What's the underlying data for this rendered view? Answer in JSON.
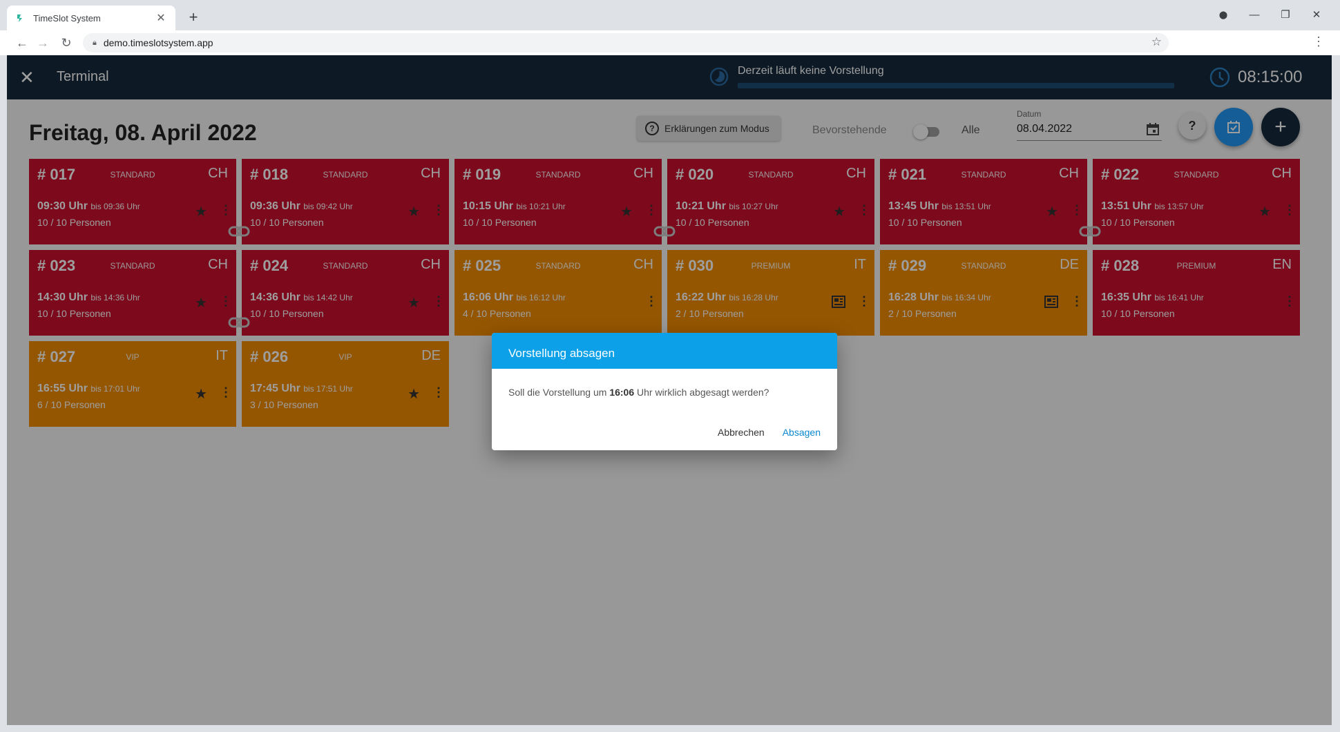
{
  "browser": {
    "tab_title": "TimeSlot System",
    "tab_close": "✕",
    "new_tab": "+",
    "url": "demo.timeslotsystem.app",
    "window_controls": {
      "profile": "⬤",
      "minimize": "—",
      "restore": "❐",
      "close": "✕"
    }
  },
  "appbar": {
    "close_icon": "✕",
    "title": "Terminal",
    "performance_status": "Derzeit läuft keine Vorstellung",
    "clock": "08:15:00"
  },
  "toolbar": {
    "heading": "Freitag, 08. April 2022",
    "explain_button": "Erklärungen zum Modus",
    "toggle_left": "Bevorstehende",
    "toggle_right": "Alle",
    "date_label": "Datum",
    "date_value": "08.04.2022",
    "help_label": "?",
    "add_label": "+"
  },
  "slots": [
    {
      "num": "# 017",
      "type": "STANDARD",
      "lang": "CH",
      "time": "09:30 Uhr",
      "until": "bis 09:36 Uhr",
      "persons": "10 / 10 Personen",
      "color": "red",
      "icon": "star"
    },
    {
      "num": "# 018",
      "type": "STANDARD",
      "lang": "CH",
      "time": "09:36 Uhr",
      "until": "bis 09:42 Uhr",
      "persons": "10 / 10 Personen",
      "color": "red",
      "icon": "star"
    },
    {
      "num": "# 019",
      "type": "STANDARD",
      "lang": "CH",
      "time": "10:15 Uhr",
      "until": "bis 10:21 Uhr",
      "persons": "10 / 10 Personen",
      "color": "red",
      "icon": "star"
    },
    {
      "num": "# 020",
      "type": "STANDARD",
      "lang": "CH",
      "time": "10:21 Uhr",
      "until": "bis 10:27 Uhr",
      "persons": "10 / 10 Personen",
      "color": "red",
      "icon": "star"
    },
    {
      "num": "# 021",
      "type": "STANDARD",
      "lang": "CH",
      "time": "13:45 Uhr",
      "until": "bis 13:51 Uhr",
      "persons": "10 / 10 Personen",
      "color": "red",
      "icon": "star"
    },
    {
      "num": "# 022",
      "type": "STANDARD",
      "lang": "CH",
      "time": "13:51 Uhr",
      "until": "bis 13:57 Uhr",
      "persons": "10 / 10 Personen",
      "color": "red",
      "icon": "star"
    },
    {
      "num": "# 023",
      "type": "STANDARD",
      "lang": "CH",
      "time": "14:30 Uhr",
      "until": "bis 14:36 Uhr",
      "persons": "10 / 10 Personen",
      "color": "red",
      "icon": "star"
    },
    {
      "num": "# 024",
      "type": "STANDARD",
      "lang": "CH",
      "time": "14:36 Uhr",
      "until": "bis 14:42 Uhr",
      "persons": "10 / 10 Personen",
      "color": "red",
      "icon": "star"
    },
    {
      "num": "# 025",
      "type": "STANDARD",
      "lang": "CH",
      "time": "16:06 Uhr",
      "until": "bis 16:12 Uhr",
      "persons": "4 / 10 Personen",
      "color": "orange",
      "icon": "none"
    },
    {
      "num": "# 030",
      "type": "PREMIUM",
      "lang": "IT",
      "time": "16:22 Uhr",
      "until": "bis 16:28 Uhr",
      "persons": "2 / 10 Personen",
      "color": "orange",
      "icon": "newspaper"
    },
    {
      "num": "# 029",
      "type": "STANDARD",
      "lang": "DE",
      "time": "16:28 Uhr",
      "until": "bis 16:34 Uhr",
      "persons": "2 / 10 Personen",
      "color": "orange",
      "icon": "newspaper"
    },
    {
      "num": "# 028",
      "type": "PREMIUM",
      "lang": "EN",
      "time": "16:35 Uhr",
      "until": "bis 16:41 Uhr",
      "persons": "10 / 10 Personen",
      "color": "red",
      "icon": "none"
    },
    {
      "num": "# 027",
      "type": "VIP",
      "lang": "IT",
      "time": "16:55 Uhr",
      "until": "bis 17:01 Uhr",
      "persons": "6 / 10 Personen",
      "color": "orange",
      "icon": "star"
    },
    {
      "num": "# 026",
      "type": "VIP",
      "lang": "DE",
      "time": "17:45 Uhr",
      "until": "bis 17:51 Uhr",
      "persons": "3 / 10 Personen",
      "color": "orange",
      "icon": "star"
    }
  ],
  "dialog": {
    "title": "Vorstellung absagen",
    "text_before": "Soll die Vorstellung um ",
    "text_time": "16:06",
    "text_after": " Uhr wirklich abgesagt werden?",
    "cancel": "Abbrechen",
    "confirm": "Absagen"
  },
  "colors": {
    "appbar": "#15293b",
    "red": "#c8102e",
    "orange": "#ef8c00",
    "dialog_header": "#0ba0e8",
    "accent": "#2196f3"
  }
}
